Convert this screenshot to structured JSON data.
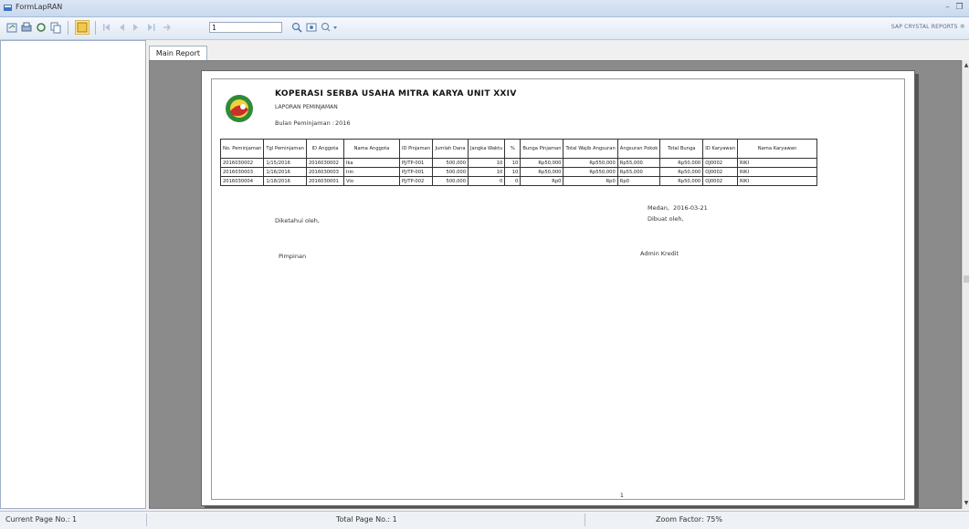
{
  "window": {
    "title": "FormLapRAN"
  },
  "toolbar": {
    "page_value": "1",
    "brand_text": "SAP CRYSTAL REPORTS ®"
  },
  "tabs": [
    {
      "label": "Main Report"
    }
  ],
  "report": {
    "title": "KOPERASI SERBA USAHA MITRA KARYA UNIT XXIV",
    "subtitle": "LAPORAN PEMINJAMAN",
    "year_label": "Bulan Peminjaman :",
    "year_value": "2016",
    "columns": [
      "No. Peminjaman",
      "Tgl Peminjaman",
      "ID Anggota",
      "Nama Anggota",
      "ID Pinjaman",
      "Jumlah Dana",
      "Jangka Waktu",
      "%",
      "Bunga Pinjaman",
      "Total Wajib Angsuran",
      "Angsuran Pokok",
      "Total Bunga",
      "ID Karyawan",
      "Nama Karyawan"
    ],
    "rows": [
      [
        "2016030002",
        "1/15/2016",
        "2016030002",
        "Ika",
        "PJ/TP-001",
        "500,000",
        "10",
        "10",
        "Rp50,000",
        "Rp550,000",
        "Rp55,000",
        "Rp50,000",
        "OJ0002",
        "RIKI"
      ],
      [
        "2016030003",
        "1/16/2016",
        "2016030003",
        "Irin",
        "PJ/TP-001",
        "500,000",
        "10",
        "10",
        "Rp50,000",
        "Rp550,000",
        "Rp55,000",
        "Rp50,000",
        "OJ0002",
        "RIKI"
      ],
      [
        "2016030004",
        "1/18/2016",
        "2016030001",
        "Vio",
        "PJ/TP-002",
        "500,000",
        "0",
        "0",
        "Rp0",
        "Rp0",
        "Rp0",
        "Rp50,000",
        "OJ0002",
        "RIKI"
      ]
    ],
    "place_date_label": "Medan,",
    "place_date_value": "2016-03-21",
    "known_by": "Diketahui oleh,",
    "made_by": "Dibuat oleh,",
    "signer_left": "Pimpinan",
    "signer_right": "Admin Kredit",
    "page_number": "1"
  },
  "status": {
    "current_page": "Current Page No.: 1",
    "total_page": "Total Page No.: 1",
    "zoom": "Zoom Factor: 75%"
  }
}
